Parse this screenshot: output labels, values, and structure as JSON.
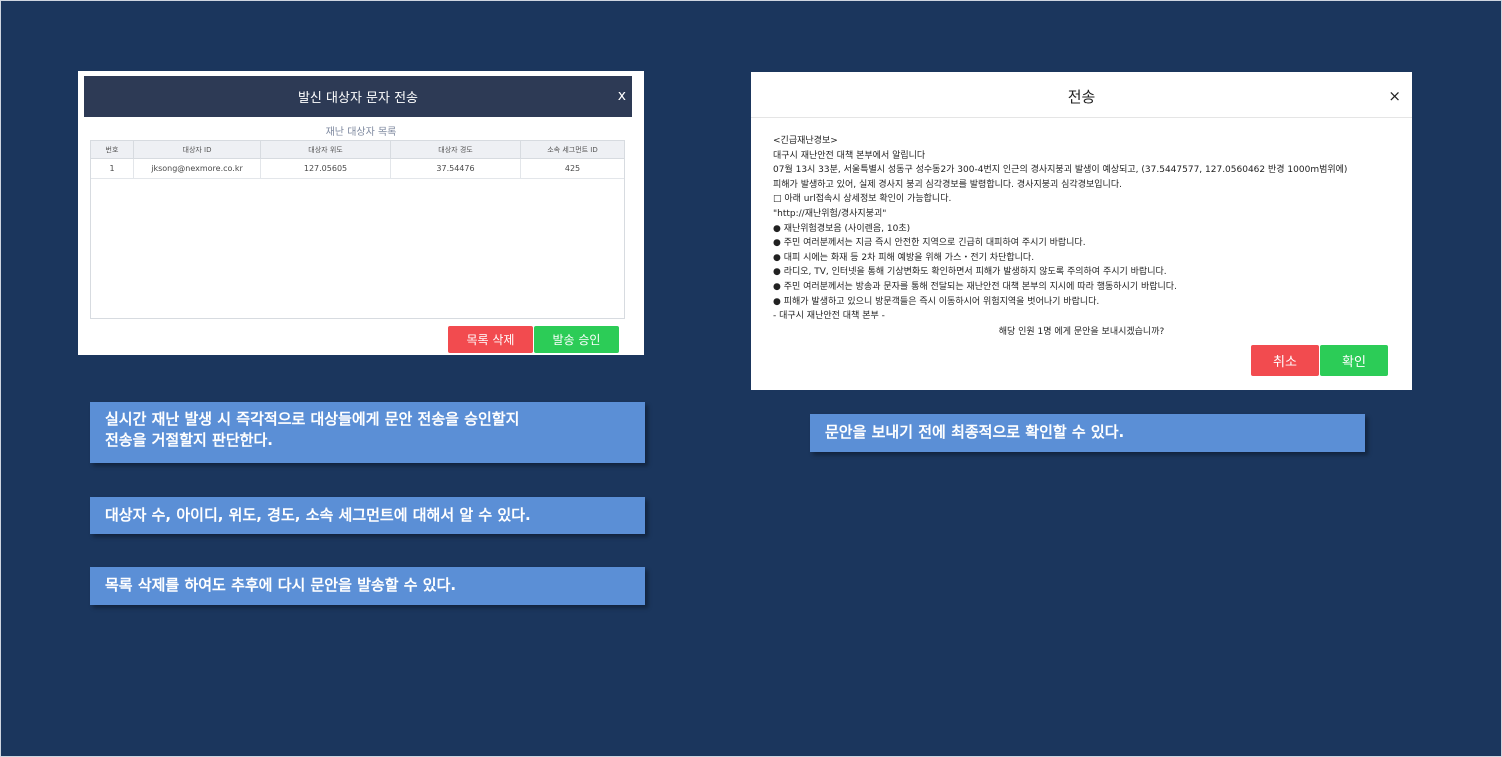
{
  "left_dialog": {
    "title": "발신 대상자 문자 전송",
    "close": "x",
    "subtitle": "재난 대상자 목록",
    "columns": [
      "번호",
      "대상자 ID",
      "대상자 위도",
      "대상자 경도",
      "소속 세그먼트 ID"
    ],
    "rows": [
      [
        "1",
        "jksong@nexmore.co.kr",
        "127.05605",
        "37.54476",
        "425"
      ]
    ],
    "delete_label": "목록 삭제",
    "approve_label": "발송 승인"
  },
  "right_dialog": {
    "title": "전송",
    "close": "×",
    "message_lines": [
      "<긴급재난경보>",
      "대구시 재난안전 대책 본부에서 알립니다",
      "07월 13시 33분, 서울특별시 성동구 성수동2가 300-4번지 인근의 경사지붕괴 발생이 예상되고, (37.5447577, 127.0560462 반경 1000m범위에)",
      "피해가 발생하고 있어, 실제 경사지 붕괴 심각경보를 발령합니다. 경사지붕괴 심각경보입니다.",
      "□ 아래 url접속시 상세정보 확인이 가능합니다.",
      "\"http://재난위험/경사지붕괴\"",
      "● 재난위험경보음 (사이렌음, 10초)",
      "● 주민 여러분께서는 지금 즉시 안전한 지역으로 긴급히 대피하여 주시기 바랍니다.",
      "● 대피 시에는 화재 등 2차 피해 예방을 위해 가스・전기 차단합니다.",
      "● 라디오, TV, 인터넷을 통해 기상변화도 확인하면서 피해가 발생하지 않도록 주의하여 주시기 바랍니다.",
      "● 주민 여러분께서는 방송과 문자를 통해 전달되는 재난안전 대책 본부의 지시에 따라 행동하시기 바랍니다.",
      "● 피해가 발생하고 있으니 방문객들은 즉시 이동하시어 위험지역을 벗어나기 바랍니다.",
      "- 대구시 재난안전 대책 본부 -"
    ],
    "confirm_question": "해당 인원 1명 에게 문안을 보내시겠습니까?",
    "cancel_label": "취소",
    "ok_label": "확인"
  },
  "captions": {
    "c1_line1": "실시간 재난 발생 시 즉각적으로 대상들에게 문안 전송을 승인할지",
    "c1_line2": "전송을 거절할지 판단한다.",
    "c2": "대상자 수, 아이디, 위도, 경도, 소속 세그먼트에 대해서 알 수 있다.",
    "c3": "목록 삭제를 하여도 추후에 다시 문안을 발송할 수 있다.",
    "c4": "문안을 보내기 전에 최종적으로 확인할 수 있다."
  },
  "colors": {
    "background": "#1b365d",
    "header": "#2d3a55",
    "danger": "#f24b4f",
    "success": "#2ccc57",
    "caption": "#5b8fd6"
  }
}
